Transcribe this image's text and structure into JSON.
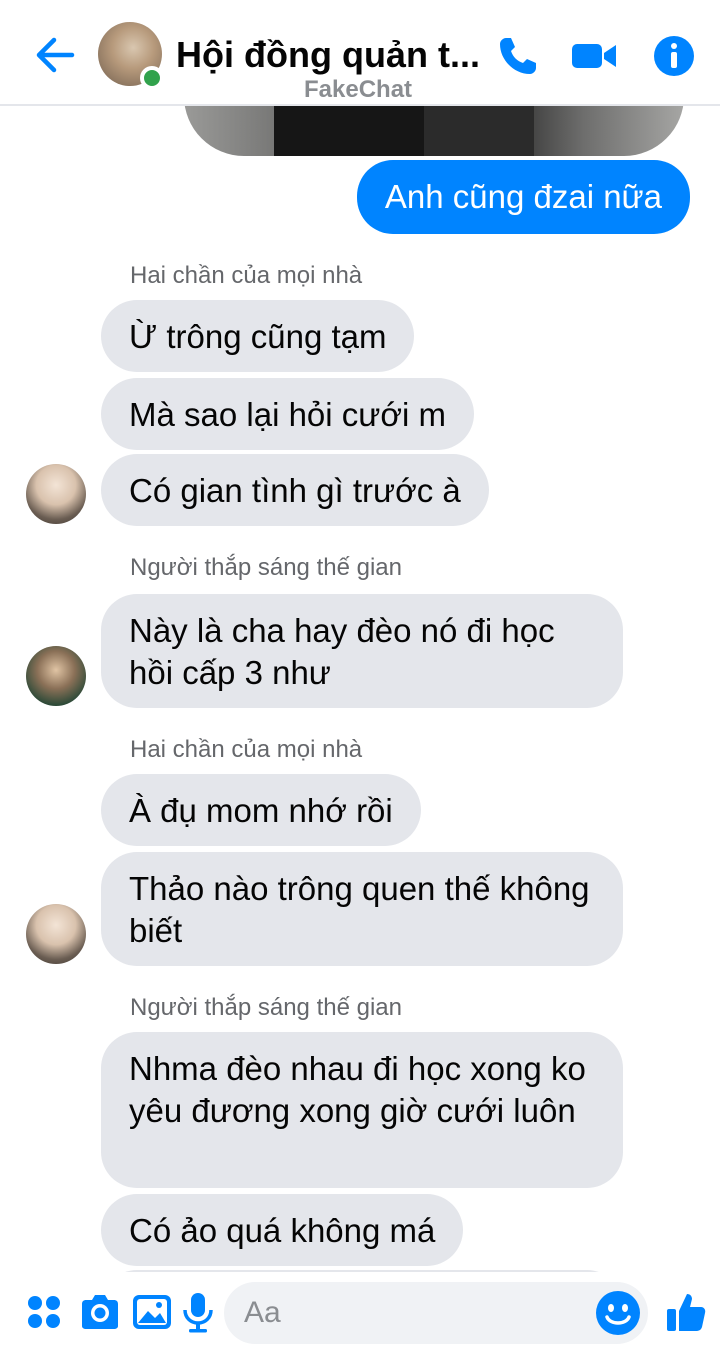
{
  "header": {
    "title": "Hội đồng quản t...",
    "watermark": "FakeChat"
  },
  "colors": {
    "accent": "#0084ff",
    "incoming_bubble": "#e4e6eb",
    "online": "#31a24c"
  },
  "icons": {
    "back": "arrow-left-icon",
    "call": "phone-icon",
    "video": "video-camera-icon",
    "info": "info-icon",
    "apps": "four-dots-icon",
    "camera": "camera-icon",
    "gallery": "image-icon",
    "mic": "microphone-icon",
    "emoji": "smiley-icon",
    "like": "thumbs-up-icon"
  },
  "messages": [
    {
      "direction": "out",
      "text": "Anh cũng đzai nữa"
    },
    {
      "direction": "in",
      "sender": "Hai chần của mọi nhà",
      "text": "Ừ trông cũng tạm"
    },
    {
      "direction": "in",
      "text": "Mà sao lại hỏi cưới m"
    },
    {
      "direction": "in",
      "text": "Có gian tình gì trước à"
    },
    {
      "direction": "in",
      "sender": "Người thắp sáng thế gian",
      "text": "Này là cha hay đèo nó đi học hồi cấp 3 như"
    },
    {
      "direction": "in",
      "sender": "Hai chần của mọi nhà",
      "text": "À đụ mom nhớ rồi"
    },
    {
      "direction": "in",
      "text": "Thảo nào trông quen thế không biết"
    },
    {
      "direction": "in",
      "sender": "Người thắp sáng thế gian",
      "text": "Nhma đèo nhau đi học xong ko yêu đương xong giờ cưới luôn"
    },
    {
      "direction": "in",
      "text": "Có ảo quá không má"
    }
  ],
  "composer": {
    "placeholder": "Aa"
  }
}
